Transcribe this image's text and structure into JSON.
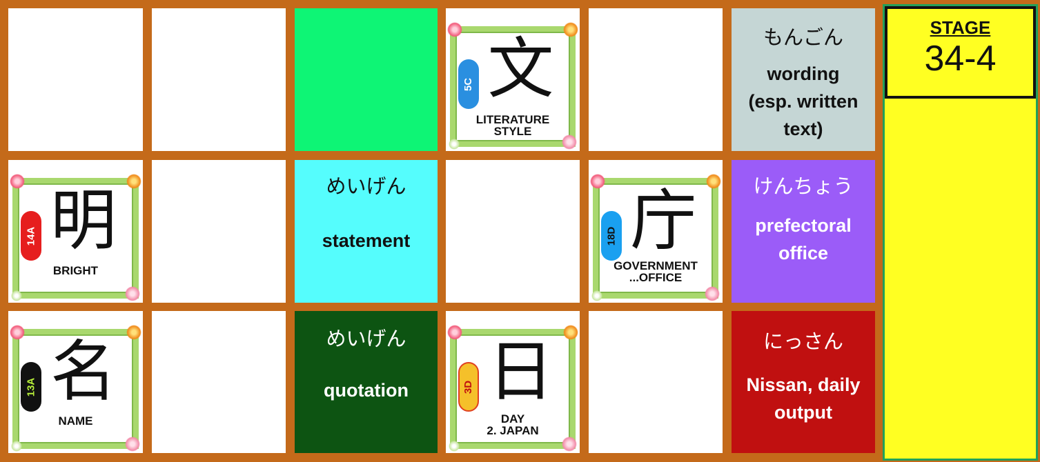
{
  "board": {
    "row1": {
      "c1": {
        "type": "blank"
      },
      "c2": {
        "type": "blank"
      },
      "c3": {
        "type": "solid",
        "color": "#0ef575"
      },
      "c4": {
        "type": "kanji",
        "kanji": "文",
        "badge": "5C",
        "badge_color": "#2a8fe0",
        "meaning1": "LITERATURE",
        "meaning2": "STYLE"
      },
      "c5": {
        "type": "blank"
      },
      "c6": {
        "type": "word",
        "kana": "もんごん",
        "english1": "wording",
        "english2": "(esp. written",
        "english3": "text)",
        "color": "#c5d6d5"
      }
    },
    "row2": {
      "c1": {
        "type": "kanji",
        "kanji": "明",
        "badge": "14A",
        "badge_color": "#e61e1e",
        "meaning1": "BRIGHT",
        "meaning2": ""
      },
      "c2": {
        "type": "blank"
      },
      "c3": {
        "type": "word",
        "kana": "めいげん",
        "english1": "statement",
        "color": "#55fdfd"
      },
      "c4": {
        "type": "blank"
      },
      "c5": {
        "type": "kanji",
        "kanji": "庁",
        "badge": "18D",
        "badge_color": "#1aa0f0",
        "meaning1": "GOVERNMENT",
        "meaning2": "...OFFICE"
      },
      "c6": {
        "type": "word",
        "kana": "けんちょう",
        "english1": "prefectoral",
        "english2": "office",
        "color": "#9b5cf8"
      }
    },
    "row3": {
      "c1": {
        "type": "kanji",
        "kanji": "名",
        "badge": "13A",
        "badge_color": "#111111",
        "meaning1": "NAME",
        "meaning2": ""
      },
      "c2": {
        "type": "blank"
      },
      "c3": {
        "type": "word",
        "kana": "めいげん",
        "english1": "quotation",
        "color": "#0d5412"
      },
      "c4": {
        "type": "kanji",
        "kanji": "日",
        "badge": "3D",
        "badge_color": "#f5c02a",
        "meaning1": "DAY",
        "meaning2": "2. JAPAN"
      },
      "c5": {
        "type": "blank"
      },
      "c6": {
        "type": "word",
        "kana": "にっさん",
        "english1": "Nissan, daily",
        "english2": "output",
        "color": "#c01010"
      }
    }
  },
  "side": {
    "stage_label": "STAGE",
    "stage_number": "34-4"
  }
}
